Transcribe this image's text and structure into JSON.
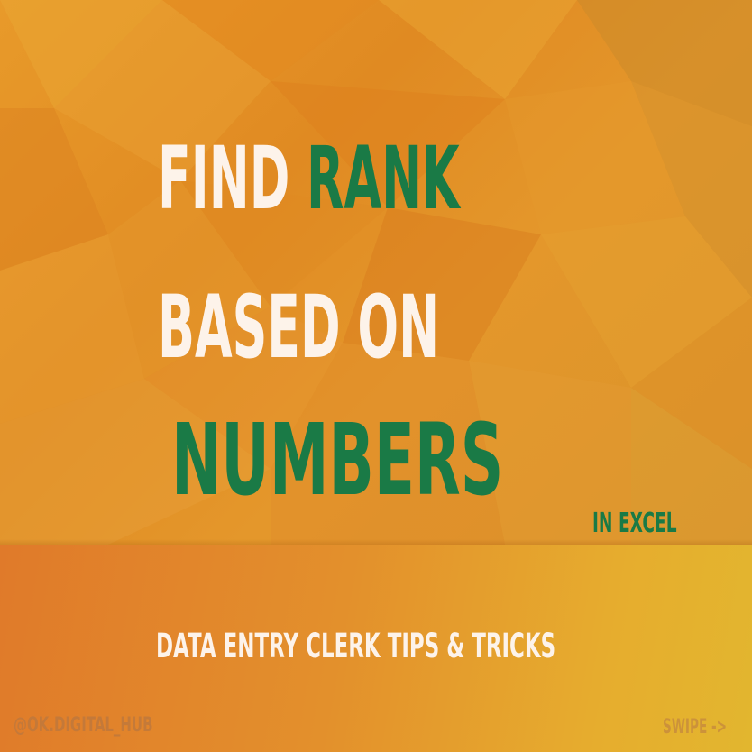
{
  "headline": {
    "line1_a": "FIND",
    "line1_b": "RANK",
    "line2": "BASED ON",
    "line3": "NUMBERS",
    "suffix": "IN EXCEL"
  },
  "tagline": "DATA ENTRY CLERK TIPS & TRICKS",
  "footer": {
    "handle": "@OK.DIGITAL_HUB",
    "swipe": "SWIPE ->"
  },
  "colors": {
    "accent_green": "#1a7a46",
    "cream_text": "#fdf3ea",
    "background_orange": "#e4922a"
  }
}
